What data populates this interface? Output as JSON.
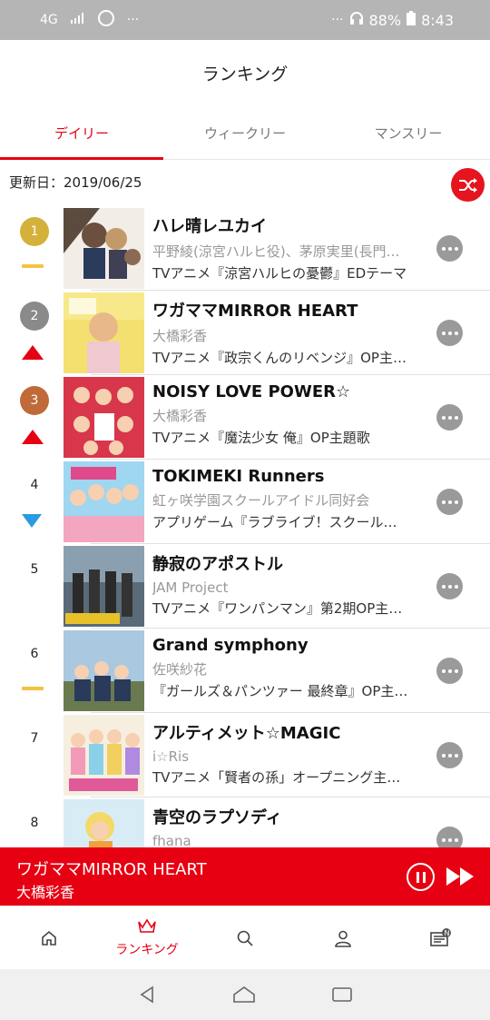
{
  "status_bar": {
    "network": "4G",
    "battery": "88%",
    "time": "8:43"
  },
  "header": {
    "title": "ランキング"
  },
  "tabs": [
    {
      "label": "デイリー",
      "active": true
    },
    {
      "label": "ウィークリー",
      "active": false
    },
    {
      "label": "マンスリー",
      "active": false
    }
  ],
  "update_date": "更新日：2019/06/25",
  "rankings": [
    {
      "rank": "1",
      "trend": "same",
      "title": "ハレ晴レユカイ",
      "artist": "平野綾(涼宮ハルヒ役)、茅原実里(長門…",
      "desc": "TVアニメ『涼宮ハルヒの憂鬱』EDテーマ"
    },
    {
      "rank": "2",
      "trend": "up",
      "title": "ワガママMIRROR HEART",
      "artist": "大橋彩香",
      "desc": "TVアニメ『政宗くんのリベンジ』OP主…"
    },
    {
      "rank": "3",
      "trend": "up",
      "title": "NOISY LOVE POWER☆",
      "artist": "大橋彩香",
      "desc": "TVアニメ『魔法少女 俺』OP主題歌"
    },
    {
      "rank": "4",
      "trend": "down",
      "title": "TOKIMEKI Runners",
      "artist": "虹ヶ咲学園スクールアイドル同好会",
      "desc": "アプリゲーム『ラブライブ！スクール…"
    },
    {
      "rank": "5",
      "trend": "none",
      "title": "静寂のアポストル",
      "artist": "JAM Project",
      "desc": "TVアニメ『ワンパンマン』第2期OP主…"
    },
    {
      "rank": "6",
      "trend": "same",
      "title": "Grand symphony",
      "artist": "佐咲紗花",
      "desc": "『ガールズ＆パンツァー 最終章』OP主…"
    },
    {
      "rank": "7",
      "trend": "none",
      "title": "アルティメット☆MAGIC",
      "artist": "i☆Ris",
      "desc": "TVアニメ「賢者の孫」オープニング主…"
    },
    {
      "rank": "8",
      "trend": "none",
      "title": "青空のラプソディ",
      "artist": "fhana",
      "desc": ""
    }
  ],
  "colors": {
    "accent": "#e60012",
    "gold": "#d4b13a",
    "silver": "#8a8a8a",
    "bronze": "#c06a3a",
    "same": "#f5c242",
    "down": "#2b9be0"
  },
  "player": {
    "title": "ワガママMIRROR HEART",
    "artist": "大橋彩香"
  },
  "nav": [
    {
      "icon": "home-icon",
      "label": ""
    },
    {
      "icon": "crown-icon",
      "label": "ランキング",
      "active": true
    },
    {
      "icon": "search-icon",
      "label": ""
    },
    {
      "icon": "person-icon",
      "label": ""
    },
    {
      "icon": "news-icon",
      "label": ""
    }
  ]
}
